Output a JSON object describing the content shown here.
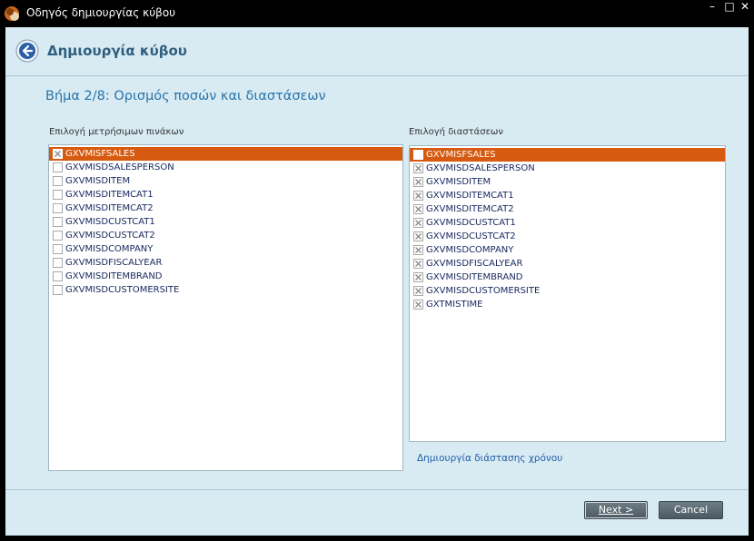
{
  "window": {
    "title": "Οδηγός δημιουργίας κύβου",
    "controls": {
      "minimize": "–",
      "maximize": "□",
      "close": "✕"
    }
  },
  "header": {
    "title": "Δημιουργία κύβου",
    "back_icon": "back-arrow-icon"
  },
  "step": {
    "title": "Βήμα 2/8: Ορισμός ποσών και διαστάσεων"
  },
  "measures": {
    "label": "Επιλογή μετρήσιμων πινάκων",
    "items": [
      {
        "name": "GXVMISFSALES",
        "checked": true,
        "selected": true
      },
      {
        "name": "GXVMISDSALESPERSON",
        "checked": false,
        "selected": false
      },
      {
        "name": "GXVMISDITEM",
        "checked": false,
        "selected": false
      },
      {
        "name": "GXVMISDITEMCAT1",
        "checked": false,
        "selected": false
      },
      {
        "name": "GXVMISDITEMCAT2",
        "checked": false,
        "selected": false
      },
      {
        "name": "GXVMISDCUSTCAT1",
        "checked": false,
        "selected": false
      },
      {
        "name": "GXVMISDCUSTCAT2",
        "checked": false,
        "selected": false
      },
      {
        "name": "GXVMISDCOMPANY",
        "checked": false,
        "selected": false
      },
      {
        "name": "GXVMISDFISCALYEAR",
        "checked": false,
        "selected": false
      },
      {
        "name": "GXVMISDITEMBRAND",
        "checked": false,
        "selected": false
      },
      {
        "name": "GXVMISDCUSTOMERSITE",
        "checked": false,
        "selected": false
      }
    ]
  },
  "dimensions": {
    "label": "Επιλογή διαστάσεων",
    "items": [
      {
        "name": "GXVMISFSALES",
        "checked": false,
        "selected": true
      },
      {
        "name": "GXVMISDSALESPERSON",
        "checked": true,
        "selected": false
      },
      {
        "name": "GXVMISDITEM",
        "checked": true,
        "selected": false
      },
      {
        "name": "GXVMISDITEMCAT1",
        "checked": true,
        "selected": false
      },
      {
        "name": "GXVMISDITEMCAT2",
        "checked": true,
        "selected": false
      },
      {
        "name": "GXVMISDCUSTCAT1",
        "checked": true,
        "selected": false
      },
      {
        "name": "GXVMISDCUSTCAT2",
        "checked": true,
        "selected": false
      },
      {
        "name": "GXVMISDCOMPANY",
        "checked": true,
        "selected": false
      },
      {
        "name": "GXVMISDFISCALYEAR",
        "checked": true,
        "selected": false
      },
      {
        "name": "GXVMISDITEMBRAND",
        "checked": true,
        "selected": false
      },
      {
        "name": "GXVMISDCUSTOMERSITE",
        "checked": true,
        "selected": false
      },
      {
        "name": "GXTMISTIME",
        "checked": true,
        "selected": false
      }
    ],
    "time_link": "Δημιουργία διάστασης χρόνου"
  },
  "buttons": {
    "next": "Next >",
    "cancel": "Cancel"
  },
  "colors": {
    "background": "#d8ebf3",
    "selection": "#d65a0f",
    "accent_text": "#2a74a8"
  }
}
